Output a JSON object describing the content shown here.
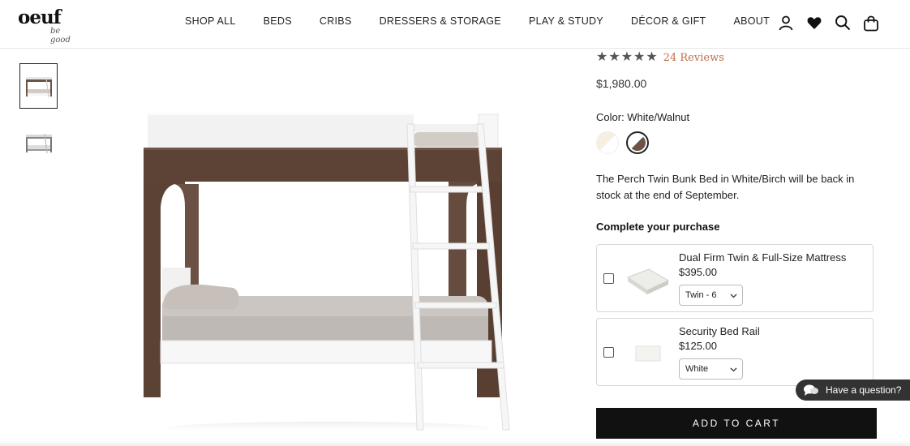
{
  "brand": {
    "name": "oeuf",
    "tagline": "be good"
  },
  "nav": {
    "items": [
      "SHOP ALL",
      "BEDS",
      "CRIBS",
      "DRESSERS & STORAGE",
      "PLAY & STUDY",
      "DÉCOR & GIFT",
      "ABOUT"
    ]
  },
  "header_icons": [
    "account-icon",
    "wishlist-heart-icon",
    "search-icon",
    "cart-bag-icon"
  ],
  "product": {
    "rating_stars": 5,
    "reviews_label": "24 Reviews",
    "price": "$1,980.00",
    "color_label": "Color: White/Walnut",
    "swatches": [
      {
        "name": "White/Birch",
        "color_a": "#f6efe2",
        "color_b": "#ffffff"
      },
      {
        "name": "White/Walnut",
        "color_a": "#6b5446",
        "color_b": "#ffffff",
        "selected": true
      }
    ],
    "stock_note": "The Perch Twin Bunk Bed in White/Birch will be back in stock at the end of September."
  },
  "complete_purchase": {
    "title": "Complete your purchase",
    "items": [
      {
        "name": "Dual Firm Twin & Full-Size Mattress",
        "price": "$395.00",
        "option": "Twin - 6",
        "checked": false
      },
      {
        "name": "Security Bed Rail",
        "price": "$125.00",
        "option": "White",
        "checked": false
      }
    ]
  },
  "add_to_cart": "ADD TO CART",
  "chat": {
    "label": "Have a question?"
  },
  "colors": {
    "accent_reviews": "#c0714c",
    "walnut": "#5c4336",
    "cart_button": "#111111",
    "chat_bg": "#333333"
  }
}
